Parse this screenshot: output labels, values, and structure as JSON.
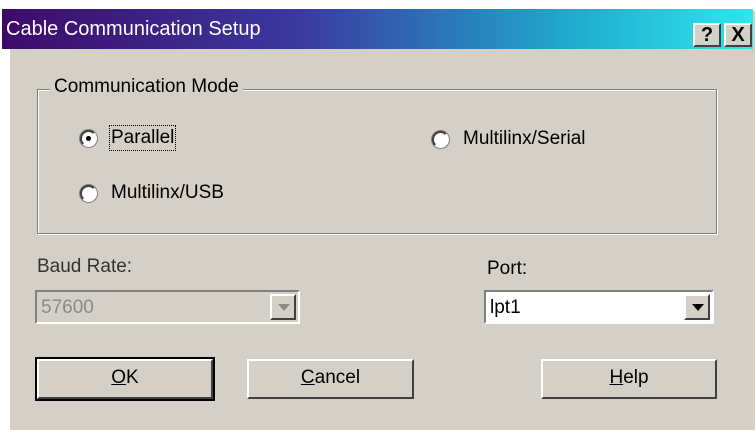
{
  "window": {
    "title": "Cable Communication Setup",
    "help_glyph": "?",
    "close_glyph": "X"
  },
  "mode_group": {
    "label": "Communication Mode",
    "options": [
      {
        "label": "Parallel",
        "selected": true
      },
      {
        "label": "Multilinx/Serial",
        "selected": false
      },
      {
        "label": "Multilinx/USB",
        "selected": false
      }
    ]
  },
  "baud": {
    "label": "Baud Rate:",
    "value": "57600",
    "enabled": false
  },
  "port": {
    "label": "Port:",
    "value": "lpt1"
  },
  "buttons": {
    "ok": {
      "accel": "O",
      "rest": "K"
    },
    "cancel": {
      "accel": "C",
      "rest": "ancel"
    },
    "help": {
      "accel": "H",
      "rest": "elp"
    }
  },
  "colors": {
    "title_start": "#3e0a6a",
    "title_end": "#2ee6ee",
    "face": "#d4d0c8"
  }
}
